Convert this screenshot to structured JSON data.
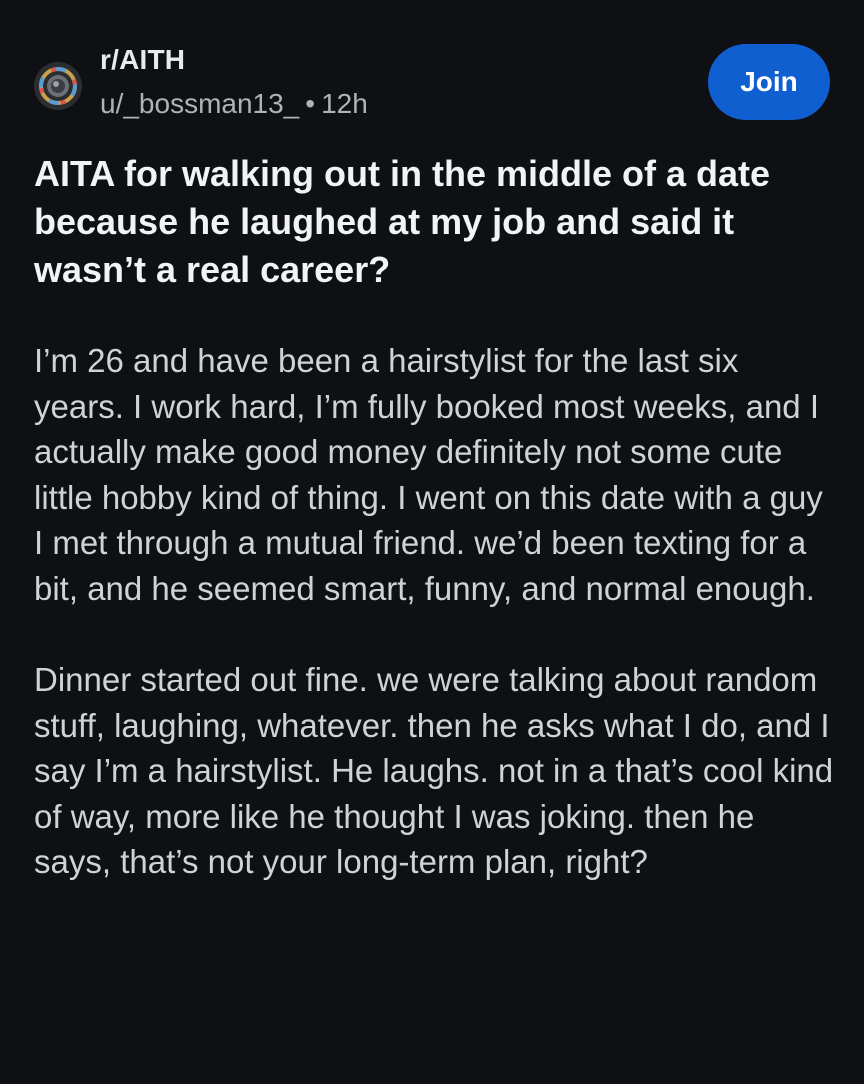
{
  "post": {
    "subreddit": "r/AITH",
    "author": "u/_bossman13_",
    "separator": "•",
    "time_ago": "12h",
    "join_label": "Join",
    "avatar_icon": "subreddit-avatar-icon",
    "title": "AITA for walking out in the middle of a date because he laughed at my job and said it wasn’t a real career?",
    "paragraphs": [
      "I’m 26 and have been a hairstylist for the last six years. I work hard, I’m fully booked most weeks, and I actually make good money definitely not some cute little hobby kind of thing. I went on this date with a guy I met through a mutual friend. we’d been texting for a bit, and he seemed smart, funny, and normal enough.",
      "Dinner started out fine. we were talking about random stuff, laughing, whatever. then he asks what I do, and I say I’m a hairstylist. He laughs. not in a that’s cool kind of way, more like he thought I was joking. then he says, that’s not your long-term plan, right?"
    ]
  },
  "colors": {
    "background": "#0e1013",
    "join_button": "#0f5fd1",
    "title_text": "#f2f3f5",
    "body_text": "#cfd3d7",
    "meta_text": "#aeb3b8"
  }
}
